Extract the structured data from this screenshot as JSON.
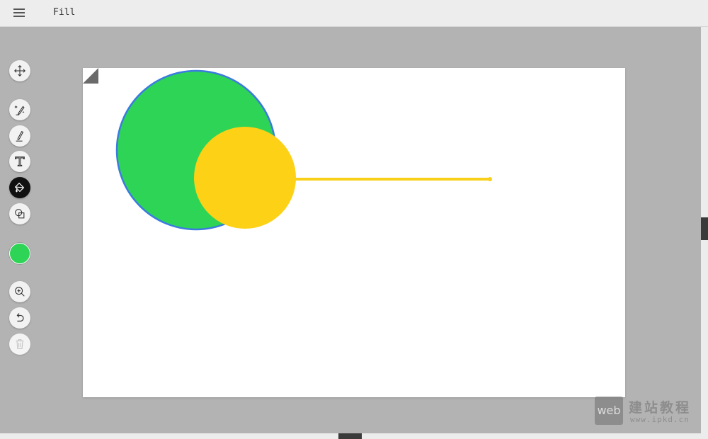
{
  "app": {
    "tool_title": "Fill",
    "menu_icon": "hamburger-menu-icon"
  },
  "toolbar": {
    "tools": [
      {
        "id": "move",
        "icon": "move-arrows-icon",
        "active": false,
        "disabled": false
      },
      {
        "id": "magic-brush",
        "icon": "magic-wand-pen-icon",
        "active": false,
        "disabled": false
      },
      {
        "id": "pen",
        "icon": "pen-icon",
        "active": false,
        "disabled": false
      },
      {
        "id": "text",
        "icon": "text-t-icon",
        "active": false,
        "disabled": false
      },
      {
        "id": "fill",
        "icon": "paint-bucket-icon",
        "active": true,
        "disabled": false
      },
      {
        "id": "shapes",
        "icon": "shapes-icon",
        "active": false,
        "disabled": false
      },
      {
        "id": "zoom",
        "icon": "zoom-in-icon",
        "active": false,
        "disabled": false
      },
      {
        "id": "undo",
        "icon": "undo-icon",
        "active": false,
        "disabled": false
      },
      {
        "id": "delete",
        "icon": "trash-icon",
        "active": false,
        "disabled": true
      }
    ],
    "current_color": "#2ed456"
  },
  "canvas": {
    "background": "#ffffff",
    "shapes": [
      {
        "type": "circle",
        "fill": "#2ed456",
        "stroke": "#3b7bdf"
      },
      {
        "type": "line",
        "stroke": "#f8d01a"
      },
      {
        "type": "circle",
        "fill": "#fcd116",
        "stroke": "none"
      }
    ]
  },
  "colors": {
    "toolbar_active": "#111111",
    "workspace": "#b3b3b3",
    "topbar": "#ededed"
  },
  "watermark": {
    "logo_text": "web",
    "name": "建站教程",
    "url": "www.ipkd.cn"
  }
}
